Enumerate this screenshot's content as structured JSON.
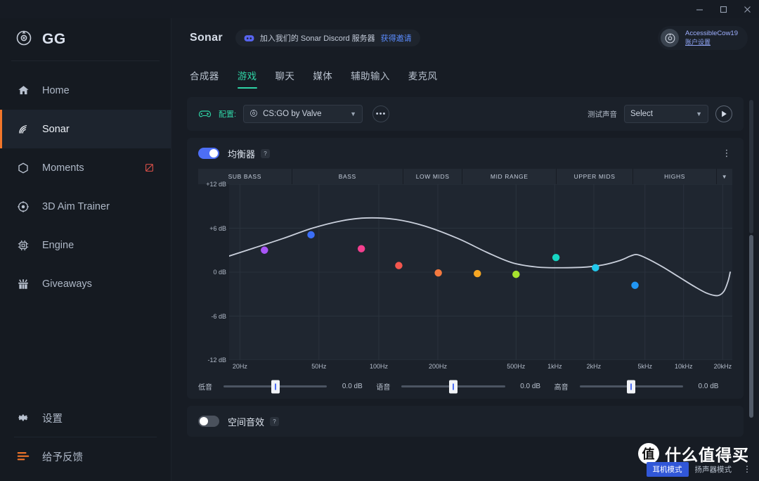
{
  "window": {
    "minimize": "—",
    "maximize": "□",
    "close": "✕"
  },
  "sidebar": {
    "brand": "GG",
    "items": [
      {
        "label": "Home",
        "icon": "home-icon"
      },
      {
        "label": "Sonar",
        "icon": "sonar-icon",
        "active": true
      },
      {
        "label": "Moments",
        "icon": "hexagon-icon",
        "badge": "record-off-icon"
      },
      {
        "label": "3D Aim Trainer",
        "icon": "target-icon"
      },
      {
        "label": "Engine",
        "icon": "chip-icon"
      },
      {
        "label": "Giveaways",
        "icon": "gift-icon"
      }
    ],
    "bottom_items": [
      {
        "label": "设置",
        "icon": "gear-icon"
      },
      {
        "label": "给予反馈",
        "icon": "feedback-icon"
      }
    ]
  },
  "header": {
    "title": "Sonar",
    "discord_text": "加入我们的 Sonar Discord 服务器",
    "discord_link": "获得邀请",
    "user_name": "AccessibleCow19",
    "user_link": "账户设置"
  },
  "tabs": [
    {
      "label": "合成器",
      "active": false
    },
    {
      "label": "游戏",
      "active": true
    },
    {
      "label": "聊天",
      "active": false
    },
    {
      "label": "媒体",
      "active": false
    },
    {
      "label": "辅助输入",
      "active": false
    },
    {
      "label": "麦克风",
      "active": false
    }
  ],
  "profile_bar": {
    "label": "配置:",
    "value": "CS:GO by Valve",
    "caret": "▼",
    "more": "•••",
    "test_label": "测试声音",
    "test_value": "Select",
    "play": "▶"
  },
  "equalizer": {
    "title": "均衡器",
    "help": "?",
    "toggle_on": true,
    "kebab": "⋮",
    "bands": [
      "SUB BASS",
      "BASS",
      "LOW MIDS",
      "MID RANGE",
      "UPPER MIDS",
      "HIGHS"
    ],
    "band_caret": "▼",
    "sliders": [
      {
        "label": "低音",
        "value": "0.0 dB",
        "pos": 50
      },
      {
        "label": "语音",
        "value": "0.0 dB",
        "pos": 50
      },
      {
        "label": "高音",
        "value": "0.0 dB",
        "pos": 50
      }
    ]
  },
  "spatial": {
    "title": "空间音效",
    "help": "?",
    "toggle_on": false
  },
  "mode_bar": {
    "tabs": [
      {
        "label": "耳机模式",
        "active": true
      },
      {
        "label": "扬声器模式",
        "active": false
      }
    ],
    "kebab": "⋮"
  },
  "watermark": {
    "mark": "值",
    "text": "什么值得买"
  },
  "colors": {
    "accent_orange": "#f2762a",
    "accent_teal": "#2fd3a5",
    "toggle_blue": "#4d6ef5",
    "discord": "#5865f2"
  },
  "chart_data": {
    "type": "line",
    "title": "均衡器",
    "xlabel": "",
    "ylabel": "dB",
    "ylim": [
      -12,
      12
    ],
    "yticks": [
      "+12 dB",
      "+6 dB",
      "0 dB",
      "-6 dB",
      "-12 dB"
    ],
    "ytick_values": [
      12,
      6,
      0,
      -6,
      -12
    ],
    "xticks": [
      "20Hz",
      "50Hz",
      "100Hz",
      "200Hz",
      "500Hz",
      "1kHz",
      "2kHz",
      "5kHz",
      "10kHz",
      "20kHz"
    ],
    "xtick_positions": [
      0.026,
      0.216,
      0.36,
      0.502,
      0.69,
      0.783,
      0.877,
      1.0,
      1.093,
      1.187
    ],
    "grid": true,
    "curve": [
      {
        "x": 0.0,
        "y": 2.2
      },
      {
        "x": 0.06,
        "y": 3.3
      },
      {
        "x": 0.13,
        "y": 4.6
      },
      {
        "x": 0.2,
        "y": 6.0
      },
      {
        "x": 0.27,
        "y": 7.0
      },
      {
        "x": 0.33,
        "y": 7.4
      },
      {
        "x": 0.4,
        "y": 7.2
      },
      {
        "x": 0.47,
        "y": 6.3
      },
      {
        "x": 0.55,
        "y": 4.6
      },
      {
        "x": 0.62,
        "y": 2.7
      },
      {
        "x": 0.68,
        "y": 1.3
      },
      {
        "x": 0.74,
        "y": 0.7
      },
      {
        "x": 0.8,
        "y": 0.6
      },
      {
        "x": 0.86,
        "y": 0.7
      },
      {
        "x": 0.9,
        "y": 1.0
      },
      {
        "x": 0.94,
        "y": 1.6
      },
      {
        "x": 0.965,
        "y": 2.2
      },
      {
        "x": 0.98,
        "y": 2.4
      },
      {
        "x": 1.0,
        "y": 2.0
      },
      {
        "x": 1.04,
        "y": 0.8
      },
      {
        "x": 1.08,
        "y": -0.6
      },
      {
        "x": 1.12,
        "y": -2.0
      },
      {
        "x": 1.15,
        "y": -2.9
      },
      {
        "x": 1.175,
        "y": -3.2
      },
      {
        "x": 1.19,
        "y": -2.6
      },
      {
        "x": 1.2,
        "y": -1.2
      },
      {
        "x": 1.205,
        "y": 0.0
      }
    ],
    "points": [
      {
        "band": "SUB BASS",
        "x": 0.085,
        "y": 3.0,
        "color": "#a855f7"
      },
      {
        "band": "BASS",
        "x": 0.197,
        "y": 5.1,
        "color": "#3b6ef6"
      },
      {
        "band": "LOW MIDS",
        "x": 0.318,
        "y": 3.2,
        "color": "#f43f8e"
      },
      {
        "band": "MID RANGE",
        "x": 0.408,
        "y": 0.9,
        "color": "#f4564e"
      },
      {
        "band": "MID RANGE",
        "x": 0.503,
        "y": -0.1,
        "color": "#f4793f"
      },
      {
        "band": "UPPER MIDS",
        "x": 0.597,
        "y": -0.2,
        "color": "#f5a623"
      },
      {
        "band": "UPPER MIDS",
        "x": 0.69,
        "y": -0.3,
        "color": "#a6e22e"
      },
      {
        "band": "HIGHS",
        "x": 0.786,
        "y": 2.0,
        "color": "#17d6c3"
      },
      {
        "band": "HIGHS",
        "x": 0.881,
        "y": 0.6,
        "color": "#22c8ec"
      },
      {
        "band": "HIGHS",
        "x": 0.976,
        "y": -1.8,
        "color": "#2196f3"
      }
    ]
  }
}
